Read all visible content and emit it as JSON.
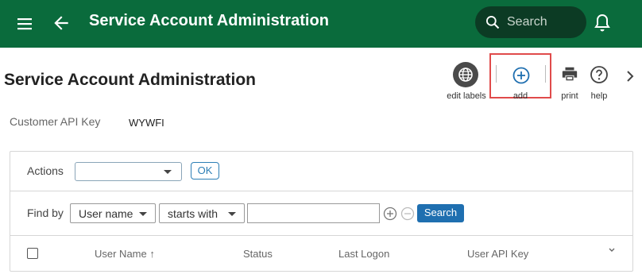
{
  "appbar": {
    "title": "Service Account Administration",
    "search_placeholder": "Search",
    "icons": [
      "menu-icon",
      "back-arrow-icon",
      "search-icon",
      "bell-icon"
    ],
    "color": "#0a6b3c"
  },
  "page": {
    "title": "Service Account Administration"
  },
  "toolbar": {
    "edit_labels": "edit labels",
    "add": "add",
    "print": "print",
    "help": "help",
    "highlight_color": "#e04b4b"
  },
  "customer": {
    "api_key_label": "Customer API Key",
    "api_key_value": "WYWFI"
  },
  "actions": {
    "label": "Actions",
    "selected": "",
    "ok_label": "OK"
  },
  "find": {
    "label": "Find by",
    "field": "User name",
    "operator": "starts with",
    "value": "",
    "search_label": "Search",
    "button_color": "#1f6fb0"
  },
  "table": {
    "columns": [
      "User Name ↑",
      "Status",
      "Last Logon",
      "User API Key"
    ],
    "sort_indicator": "↑"
  }
}
